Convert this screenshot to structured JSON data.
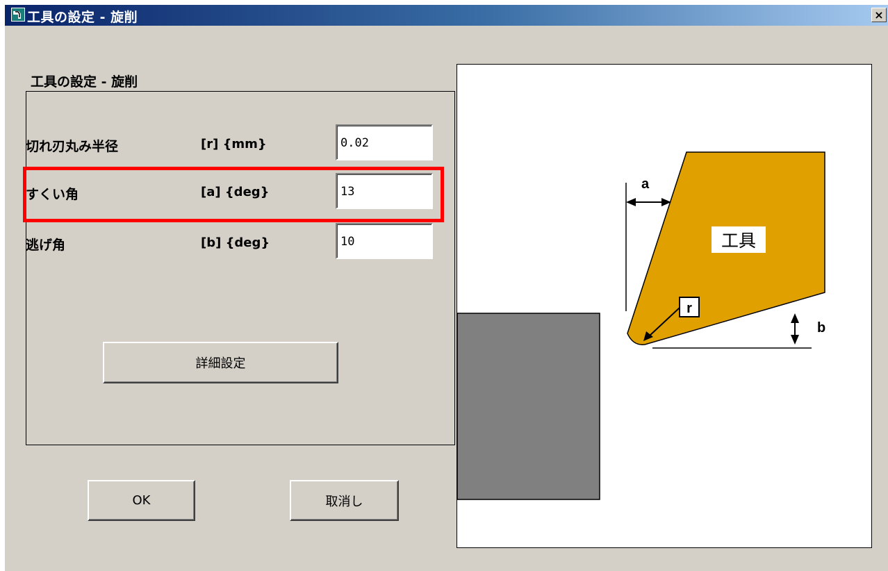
{
  "window": {
    "title": "工具の設定 - 旋削",
    "close_glyph": "×"
  },
  "group": {
    "title": "工具の設定 - 旋削"
  },
  "params": [
    {
      "label": "切れ刃丸み半径",
      "unit": "[r] {mm}",
      "value": "0.02"
    },
    {
      "label": "すくい角",
      "unit": "[a] {deg}",
      "value": "13"
    },
    {
      "label": "逃げ角",
      "unit": "[b] {deg}",
      "value": "10"
    }
  ],
  "buttons": {
    "detail": "詳細設定",
    "ok": "OK",
    "cancel": "取消し"
  },
  "diagram": {
    "tool_label": "工具",
    "label_a": "a",
    "label_b": "b",
    "label_r": "r",
    "colors": {
      "tool": "#e0a000",
      "workpiece": "#808080"
    }
  },
  "highlight": {
    "color": "#ff0000"
  }
}
